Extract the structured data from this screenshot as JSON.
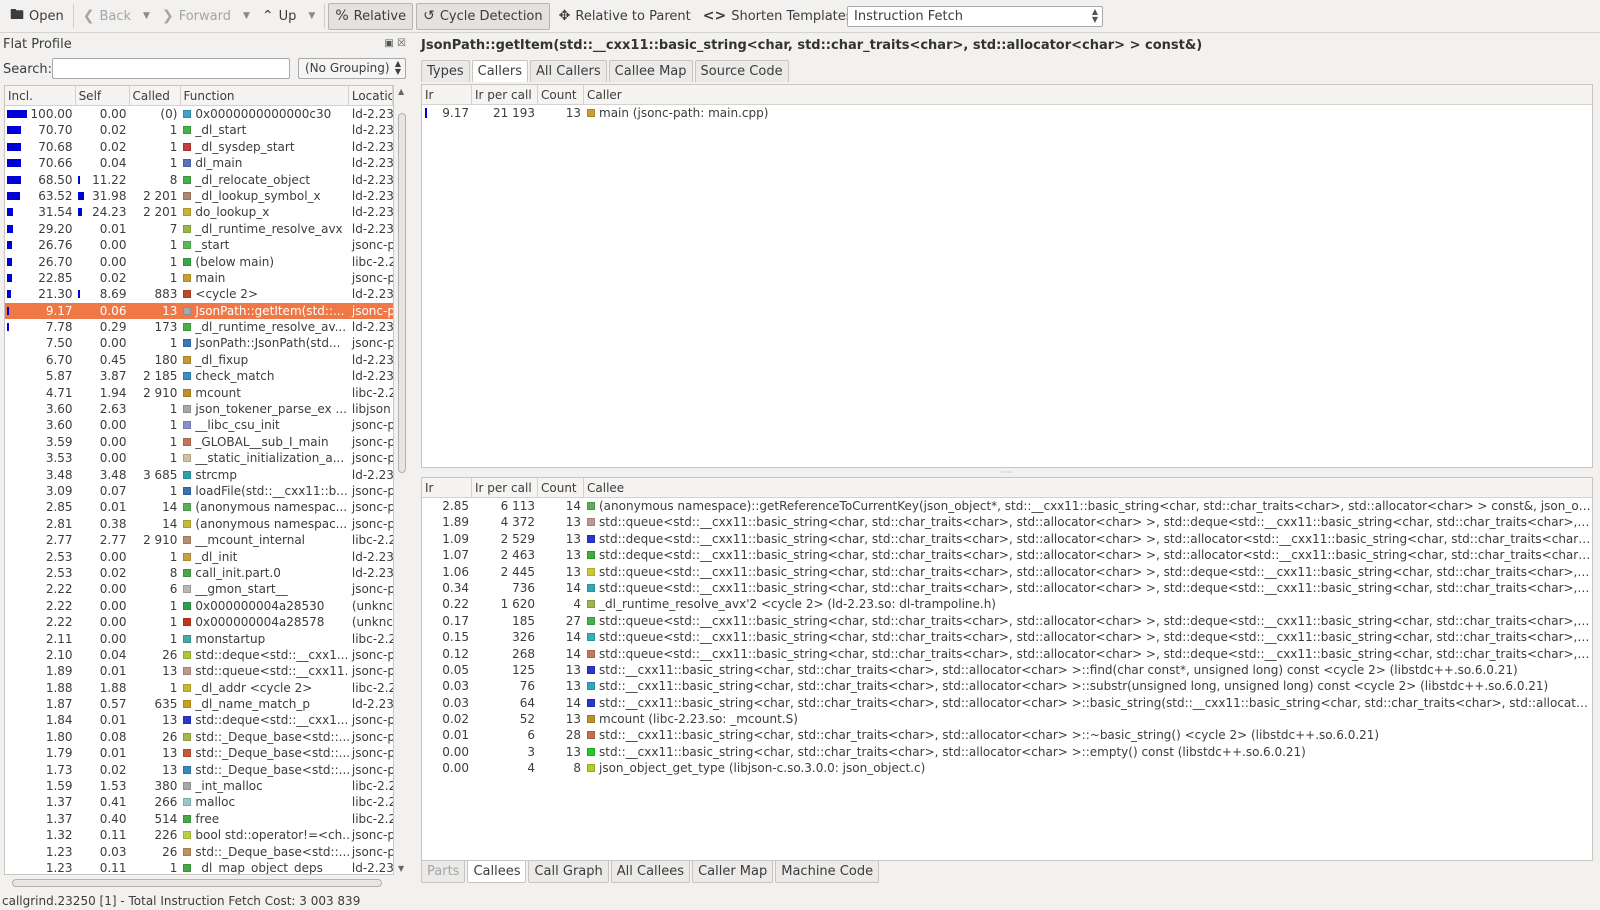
{
  "toolbar": {
    "open": "Open",
    "back": "Back",
    "forward": "Forward",
    "up": "Up",
    "relative": "Relative",
    "cycle_detection": "Cycle Detection",
    "relative_to_parent": "Relative to Parent",
    "shorten_templates": "Shorten Templates",
    "event_type": "Instruction Fetch"
  },
  "flat_profile": {
    "title": "Flat Profile",
    "search_label": "Search:",
    "search_value": "",
    "grouping": "(No Grouping)",
    "columns": [
      "Incl.",
      "Self",
      "Called",
      "Function",
      "Location"
    ],
    "rows": [
      {
        "incl": "100.00",
        "self": "0.00",
        "called": "(0)",
        "fn": "0x0000000000000c30",
        "loc": "ld-2.23",
        "color": "#3aa3c7",
        "ibar": 1.0,
        "sbar": 0
      },
      {
        "incl": "70.70",
        "self": "0.02",
        "called": "1",
        "fn": "_dl_start",
        "loc": "ld-2.23",
        "color": "#48b24a",
        "ibar": 0.707,
        "sbar": 0
      },
      {
        "incl": "70.68",
        "self": "0.02",
        "called": "1",
        "fn": "_dl_sysdep_start",
        "loc": "ld-2.23",
        "color": "#c0403c",
        "ibar": 0.707,
        "sbar": 0
      },
      {
        "incl": "70.66",
        "self": "0.04",
        "called": "1",
        "fn": "dl_main",
        "loc": "ld-2.23",
        "color": "#5874b8",
        "ibar": 0.706,
        "sbar": 0
      },
      {
        "incl": "68.50",
        "self": "11.22",
        "called": "8",
        "fn": "_dl_relocate_object",
        "loc": "ld-2.23",
        "color": "#46b04a",
        "ibar": 0.685,
        "sbar": 0.112
      },
      {
        "incl": "63.52",
        "self": "31.98",
        "called": "2 201",
        "fn": "_dl_lookup_symbol_x",
        "loc": "ld-2.23",
        "color": "#b0866c",
        "ibar": 0.635,
        "sbar": 0.32
      },
      {
        "incl": "31.54",
        "self": "24.23",
        "called": "2 201",
        "fn": "do_lookup_x",
        "loc": "ld-2.23",
        "color": "#c8b430",
        "ibar": 0.315,
        "sbar": 0.242
      },
      {
        "incl": "29.20",
        "self": "0.01",
        "called": "7",
        "fn": "_dl_runtime_resolve_avx",
        "loc": "ld-2.23",
        "color": "#98b848",
        "ibar": 0.292,
        "sbar": 0
      },
      {
        "incl": "26.76",
        "self": "0.00",
        "called": "1",
        "fn": "_start",
        "loc": "jsonc-p",
        "color": "#5cb85c",
        "ibar": 0.268,
        "sbar": 0
      },
      {
        "incl": "26.70",
        "self": "0.00",
        "called": "1",
        "fn": "(below main)",
        "loc": "libc-2.2",
        "color": "#38a84a",
        "ibar": 0.267,
        "sbar": 0
      },
      {
        "incl": "22.85",
        "self": "0.02",
        "called": "1",
        "fn": "main",
        "loc": "jsonc-p",
        "color": "#c8a030",
        "ibar": 0.229,
        "sbar": 0
      },
      {
        "incl": "21.30",
        "self": "8.69",
        "called": "883",
        "fn": "<cycle 2>",
        "loc": "ld-2.23",
        "color": "#c04828",
        "ibar": 0.213,
        "sbar": 0.087
      },
      {
        "incl": "9.17",
        "self": "0.06",
        "called": "13",
        "fn": "JsonPath::getItem(std::...",
        "loc": "jsonc-p",
        "color": "#a8a8a8",
        "ibar": 0.092,
        "sbar": 0,
        "selected": true
      },
      {
        "incl": "7.78",
        "self": "0.29",
        "called": "173",
        "fn": "_dl_runtime_resolve_av...",
        "loc": "ld-2.23",
        "color": "#48b048",
        "ibar": 0.078,
        "sbar": 0
      },
      {
        "incl": "7.50",
        "self": "0.00",
        "called": "1",
        "fn": "JsonPath::JsonPath(std...",
        "loc": "jsonc-p",
        "color": "#3878b8",
        "ibar": 0,
        "sbar": 0
      },
      {
        "incl": "6.70",
        "self": "0.45",
        "called": "180",
        "fn": "_dl_fixup",
        "loc": "ld-2.23",
        "color": "#c89830",
        "ibar": 0,
        "sbar": 0
      },
      {
        "incl": "5.87",
        "self": "3.87",
        "called": "2 185",
        "fn": "check_match",
        "loc": "ld-2.23",
        "color": "#3890c0",
        "ibar": 0,
        "sbar": 0
      },
      {
        "incl": "4.71",
        "self": "1.94",
        "called": "2 910",
        "fn": "mcount",
        "loc": "libc-2.2",
        "color": "#c09030",
        "ibar": 0,
        "sbar": 0
      },
      {
        "incl": "3.60",
        "self": "2.63",
        "called": "1",
        "fn": "json_tokener_parse_ex ...",
        "loc": "libjson",
        "color": "#a8a8a8",
        "ibar": 0,
        "sbar": 0
      },
      {
        "incl": "3.60",
        "self": "0.00",
        "called": "1",
        "fn": "__libc_csu_init",
        "loc": "jsonc-p",
        "color": "#8890d0",
        "ibar": 0,
        "sbar": 0
      },
      {
        "incl": "3.59",
        "self": "0.00",
        "called": "1",
        "fn": "_GLOBAL__sub_I_main",
        "loc": "jsonc-p",
        "color": "#c07858",
        "ibar": 0,
        "sbar": 0
      },
      {
        "incl": "3.53",
        "self": "0.00",
        "called": "1",
        "fn": "__static_initialization_a...",
        "loc": "jsonc-p",
        "color": "#d0c0a0",
        "ibar": 0,
        "sbar": 0
      },
      {
        "incl": "3.48",
        "self": "3.48",
        "called": "3 685",
        "fn": "strcmp",
        "loc": "ld-2.23",
        "color": "#30a0b0",
        "ibar": 0,
        "sbar": 0
      },
      {
        "incl": "3.09",
        "self": "0.07",
        "called": "1",
        "fn": "loadFile(std::__cxx11::b...",
        "loc": "jsonc-p",
        "color": "#3870b0",
        "ibar": 0,
        "sbar": 0
      },
      {
        "incl": "2.85",
        "self": "0.01",
        "called": "14",
        "fn": "(anonymous namespac...",
        "loc": "jsonc-p",
        "color": "#58b058",
        "ibar": 0,
        "sbar": 0
      },
      {
        "incl": "2.81",
        "self": "0.38",
        "called": "14",
        "fn": "(anonymous namespac...",
        "loc": "jsonc-p",
        "color": "#c8b838",
        "ibar": 0,
        "sbar": 0
      },
      {
        "incl": "2.77",
        "self": "2.77",
        "called": "2 910",
        "fn": "__mcount_internal",
        "loc": "libc-2.2",
        "color": "#b89070",
        "ibar": 0,
        "sbar": 0
      },
      {
        "incl": "2.53",
        "self": "0.00",
        "called": "1",
        "fn": "_dl_init",
        "loc": "ld-2.23",
        "color": "#c8a040",
        "ibar": 0,
        "sbar": 0
      },
      {
        "incl": "2.53",
        "self": "0.02",
        "called": "8",
        "fn": "call_init.part.0",
        "loc": "ld-2.23",
        "color": "#48a848",
        "ibar": 0,
        "sbar": 0
      },
      {
        "incl": "2.22",
        "self": "0.00",
        "called": "6",
        "fn": "__gmon_start__",
        "loc": "jsonc-p",
        "color": "#b8b8b8",
        "ibar": 0,
        "sbar": 0
      },
      {
        "incl": "2.22",
        "self": "0.00",
        "called": "1",
        "fn": "0x000000004a28530",
        "loc": "(unknc",
        "color": "#30a050",
        "ibar": 0,
        "sbar": 0
      },
      {
        "incl": "2.22",
        "self": "0.00",
        "called": "1",
        "fn": "0x000000004a28578",
        "loc": "(unknc",
        "color": "#c03818",
        "ibar": 0,
        "sbar": 0
      },
      {
        "incl": "2.11",
        "self": "0.00",
        "called": "1",
        "fn": "monstartup",
        "loc": "libc-2.2",
        "color": "#48a8a8",
        "ibar": 0,
        "sbar": 0
      },
      {
        "incl": "2.10",
        "self": "0.04",
        "called": "26",
        "fn": "std::deque<std::__cxx1...",
        "loc": "jsonc-p",
        "color": "#a8c838",
        "ibar": 0,
        "sbar": 0
      },
      {
        "incl": "1.89",
        "self": "0.01",
        "called": "13",
        "fn": "std::queue<std::__cxx11...",
        "loc": "jsonc-p",
        "color": "#c09890",
        "ibar": 0,
        "sbar": 0
      },
      {
        "incl": "1.88",
        "self": "1.88",
        "called": "1",
        "fn": "_dl_addr <cycle 2>",
        "loc": "libc-2.2",
        "color": "#c8b830",
        "ibar": 0,
        "sbar": 0
      },
      {
        "incl": "1.87",
        "self": "0.57",
        "called": "635",
        "fn": "_dl_name_match_p",
        "loc": "ld-2.23",
        "color": "#c8a020",
        "ibar": 0,
        "sbar": 0
      },
      {
        "incl": "1.84",
        "self": "0.01",
        "called": "13",
        "fn": "std::deque<std::__cxx1...",
        "loc": "jsonc-p",
        "color": "#2838c8",
        "ibar": 0,
        "sbar": 0
      },
      {
        "incl": "1.80",
        "self": "0.08",
        "called": "26",
        "fn": "std::_Deque_base<std::...",
        "loc": "jsonc-p",
        "color": "#a8b848",
        "ibar": 0,
        "sbar": 0
      },
      {
        "incl": "1.79",
        "self": "0.01",
        "called": "13",
        "fn": "std::_Deque_base<std::...",
        "loc": "jsonc-p",
        "color": "#c85838",
        "ibar": 0,
        "sbar": 0
      },
      {
        "incl": "1.73",
        "self": "0.02",
        "called": "13",
        "fn": "std::_Deque_base<std::...",
        "loc": "jsonc-p",
        "color": "#3888c0",
        "ibar": 0,
        "sbar": 0
      },
      {
        "incl": "1.59",
        "self": "1.53",
        "called": "380",
        "fn": "_int_malloc",
        "loc": "libc-2.2",
        "color": "#a8a8a8",
        "ibar": 0,
        "sbar": 0
      },
      {
        "incl": "1.37",
        "self": "0.41",
        "called": "266",
        "fn": "malloc",
        "loc": "libc-2.2",
        "color": "#98c8c8",
        "ibar": 0,
        "sbar": 0
      },
      {
        "incl": "1.37",
        "self": "0.40",
        "called": "514",
        "fn": "free",
        "loc": "libc-2.2",
        "color": "#48a848",
        "ibar": 0,
        "sbar": 0
      },
      {
        "incl": "1.32",
        "self": "0.11",
        "called": "226",
        "fn": "bool std::operator!=<ch...",
        "loc": "jsonc-p",
        "color": "#b8d048",
        "ibar": 0,
        "sbar": 0
      },
      {
        "incl": "1.23",
        "self": "0.03",
        "called": "26",
        "fn": "std::_Deque_base<std::...",
        "loc": "jsonc-p",
        "color": "#c09060",
        "ibar": 0,
        "sbar": 0
      },
      {
        "incl": "1.23",
        "self": "0.11",
        "called": "1",
        "fn": "_dl_map_object_deps",
        "loc": "ld-2.23",
        "color": "#48a848",
        "ibar": 0,
        "sbar": 0
      }
    ]
  },
  "detail": {
    "title": "JsonPath::getItem(std::__cxx11::basic_string<char, std::char_traits<char>, std::allocator<char> > const&)",
    "top_tabs": [
      "Types",
      "Callers",
      "All Callers",
      "Callee Map",
      "Source Code"
    ],
    "top_active": 1,
    "callers": {
      "columns": [
        "Ir",
        "Ir per call",
        "Count",
        "Caller"
      ],
      "rows": [
        {
          "ir": "9.17",
          "ipc": "21 193",
          "count": "13",
          "name": "main (jsonc-path: main.cpp)",
          "color": "#c8a030"
        }
      ]
    },
    "callees": {
      "columns": [
        "Ir",
        "Ir per call",
        "Count",
        "Callee"
      ],
      "rows": [
        {
          "ir": "2.85",
          "ipc": "6 113",
          "count": "14",
          "name": "(anonymous namespace)::getReferenceToCurrentKey(json_object*, std::__cxx11::basic_string<char, std::char_traits<char>, std::allocator<char> > const&, json_object*...",
          "color": "#58b058"
        },
        {
          "ir": "1.89",
          "ipc": "4 372",
          "count": "13",
          "name": "std::queue<std::__cxx11::basic_string<char, std::char_traits<char>, std::allocator<char> >, std::deque<std::__cxx11::basic_string<char, std::char_traits<char>, std::allocat...",
          "color": "#c09890"
        },
        {
          "ir": "1.09",
          "ipc": "2 529",
          "count": "13",
          "name": "std::deque<std::__cxx11::basic_string<char, std::char_traits<char>, std::allocator<char> >, std::allocator<std::__cxx11::basic_string<char, std::char_traits<char>, std::allo...",
          "color": "#2838c8"
        },
        {
          "ir": "1.07",
          "ipc": "2 463",
          "count": "13",
          "name": "std::deque<std::__cxx11::basic_string<char, std::char_traits<char>, std::allocator<char> >, std::allocator<std::__cxx11::basic_string<char, std::char_traits<char>, std::allo...",
          "color": "#38b038"
        },
        {
          "ir": "1.06",
          "ipc": "2 445",
          "count": "13",
          "name": "std::queue<std::__cxx11::basic_string<char, std::char_traits<char>, std::allocator<char> >, std::deque<std::__cxx11::basic_string<char, std::char_traits<char>, std::allocat...",
          "color": "#c8c838"
        },
        {
          "ir": "0.34",
          "ipc": "736",
          "count": "14",
          "name": "std::queue<std::__cxx11::basic_string<char, std::char_traits<char>, std::allocator<char> >, std::deque<std::__cxx11::basic_string<char, std::char_traits<char>, std::allocat...",
          "color": "#30a8b8"
        },
        {
          "ir": "0.22",
          "ipc": "1 620",
          "count": "4",
          "name": "_dl_runtime_resolve_avx'2 <cycle 2> (ld-2.23.so: dl-trampoline.h)",
          "color": "#98b848"
        },
        {
          "ir": "0.17",
          "ipc": "185",
          "count": "27",
          "name": "std::queue<std::__cxx11::basic_string<char, std::char_traits<char>, std::allocator<char> >, std::deque<std::__cxx11::basic_string<char, std::char_traits<char>, std::allocat...",
          "color": "#48b048"
        },
        {
          "ir": "0.15",
          "ipc": "326",
          "count": "14",
          "name": "std::queue<std::__cxx11::basic_string<char, std::char_traits<char>, std::allocator<char> >, std::deque<std::__cxx11::basic_string<char, std::char_traits<char>, std::allocat...",
          "color": "#30b0b8"
        },
        {
          "ir": "0.12",
          "ipc": "268",
          "count": "14",
          "name": "std::queue<std::__cxx11::basic_string<char, std::char_traits<char>, std::allocator<char> >, std::deque<std::__cxx11::basic_string<char, std::char_traits<char>, std::allocat...",
          "color": "#c07860"
        },
        {
          "ir": "0.05",
          "ipc": "125",
          "count": "13",
          "name": "std::__cxx11::basic_string<char, std::char_traits<char>, std::allocator<char> >::find(char const*, unsigned long) const <cycle 2> (libstdc++.so.6.0.21)",
          "color": "#2838c8"
        },
        {
          "ir": "0.03",
          "ipc": "76",
          "count": "13",
          "name": "std::__cxx11::basic_string<char, std::char_traits<char>, std::allocator<char> >::substr(unsigned long, unsigned long) const <cycle 2> (libstdc++.so.6.0.21)",
          "color": "#30a8b8"
        },
        {
          "ir": "0.03",
          "ipc": "64",
          "count": "14",
          "name": "std::__cxx11::basic_string<char, std::char_traits<char>, std::allocator<char> >::basic_string(std::__cxx11::basic_string<char, std::char_traits<char>, std::allocator<char> >...",
          "color": "#2838c8"
        },
        {
          "ir": "0.02",
          "ipc": "52",
          "count": "13",
          "name": "mcount (libc-2.23.so: _mcount.S)",
          "color": "#c09030"
        },
        {
          "ir": "0.01",
          "ipc": "6",
          "count": "28",
          "name": "std::__cxx11::basic_string<char, std::char_traits<char>, std::allocator<char> >::~basic_string() <cycle 2> (libstdc++.so.6.0.21)",
          "color": "#c07050"
        },
        {
          "ir": "0.00",
          "ipc": "3",
          "count": "13",
          "name": "std::__cxx11::basic_string<char, std::char_traits<char>, std::allocator<char> >::empty() const (libstdc++.so.6.0.21)",
          "color": "#28c828"
        },
        {
          "ir": "0.00",
          "ipc": "4",
          "count": "8",
          "name": "json_object_get_type (libjson-c.so.3.0.0: json_object.c)",
          "color": "#b8c828"
        }
      ]
    },
    "bottom_tabs": [
      "Parts",
      "Callees",
      "Call Graph",
      "All Callees",
      "Caller Map",
      "Machine Code"
    ],
    "bottom_active": 1
  },
  "status": "callgrind.23250 [1] - Total Instruction Fetch Cost: 3 003 839"
}
